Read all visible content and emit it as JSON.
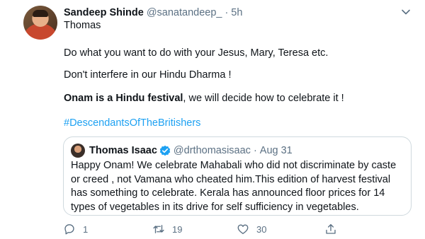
{
  "tweet": {
    "author_name": "Sandeep Shinde",
    "handle": "@sanatandeep_",
    "separator": "·",
    "time": "5h",
    "lines": {
      "line1": "Thomas",
      "line2": "Do what you want to do with your Jesus, Mary, Teresa etc.",
      "line3": "Don't interfere in our Hindu Dharma !",
      "line4_bold": "Onam is a Hindu festival",
      "line4_rest": ", we will decide how to celebrate it !",
      "hashtag": "#DescendantsOfTheBritishers"
    }
  },
  "quoted": {
    "author_name": "Thomas Isaac",
    "handle": "@drthomasisaac",
    "separator": "·",
    "date": "Aug 31",
    "body": "Happy Onam! We celebrate Mahabali who did not discriminate by caste\nor creed , not Vamana who cheated  him.This edition of harvest festival\nhas something to celebrate. Kerala has announced floor prices for 14\ntypes of vegetables in its drive for self sufficiency in vegetables."
  },
  "actions": {
    "reply_count": "1",
    "retweet_count": "19",
    "like_count": "30"
  },
  "colors": {
    "accent": "#1da1f2",
    "secondary_text": "#5b7083",
    "border": "#cfd9de"
  },
  "icons": [
    "chevron-down-icon",
    "verified-badge-icon",
    "reply-icon",
    "retweet-icon",
    "like-icon",
    "share-icon"
  ]
}
